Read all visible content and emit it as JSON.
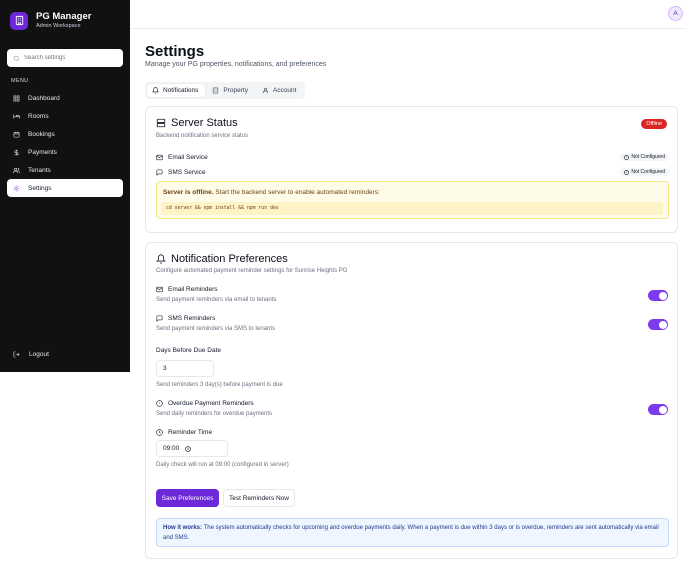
{
  "app": {
    "title": "PG Manager",
    "subtitle": "Admin Workspace"
  },
  "sidebar": {
    "search_placeholder": "Search settings",
    "menu_label": "MENU",
    "items": [
      {
        "label": "Dashboard",
        "icon": "grid-icon"
      },
      {
        "label": "Rooms",
        "icon": "bed-icon"
      },
      {
        "label": "Bookings",
        "icon": "calendar-icon"
      },
      {
        "label": "Payments",
        "icon": "dollar-icon"
      },
      {
        "label": "Tenants",
        "icon": "users-icon"
      },
      {
        "label": "Settings",
        "icon": "gear-icon",
        "active": true
      }
    ],
    "logout_label": "Logout"
  },
  "topbar": {
    "avatar_initial": "A"
  },
  "page": {
    "title": "Settings",
    "subtitle": "Manage your PG properties, notifications, and preferences"
  },
  "tabs": [
    {
      "label": "Notifications",
      "icon": "bell-icon",
      "active": true
    },
    {
      "label": "Property",
      "icon": "building-icon"
    },
    {
      "label": "Account",
      "icon": "user-icon"
    }
  ],
  "server_status": {
    "title": "Server Status",
    "description": "Backend notification service status",
    "status_badge": "Offline",
    "services": [
      {
        "label": "Email Service",
        "icon": "mail-icon",
        "status": "Not Configured"
      },
      {
        "label": "SMS Service",
        "icon": "message-icon",
        "status": "Not Configured"
      }
    ],
    "warning_strong": "Server is offline.",
    "warning_text": " Start the backend server to enable automated reminders:",
    "warning_code": "cd server && npm install && npm run dev"
  },
  "preferences": {
    "title": "Notification Preferences",
    "description": "Configure automated payment reminder settings for Sunrise Heights PG",
    "email": {
      "label": "Email Reminders",
      "desc": "Send payment reminders via email to tenants",
      "enabled": true
    },
    "sms": {
      "label": "SMS Reminders",
      "desc": "Send payment reminders via SMS to tenants",
      "enabled": true
    },
    "days": {
      "label": "Days Before Due Date",
      "value": "3",
      "desc": "Send reminders 3 day(s) before payment is due"
    },
    "overdue": {
      "label": "Overdue Payment Reminders",
      "desc": "Send daily reminders for overdue payments",
      "enabled": true
    },
    "time": {
      "label": "Reminder Time",
      "value": "09:00",
      "desc": "Daily check will run at 09:00 (configured in server)"
    },
    "save_label": "Save Preferences",
    "test_label": "Test Reminders Now",
    "info_strong": "How it works:",
    "info_text": " The system automatically checks for upcoming and overdue payments daily. When a payment is due within 3 days or is overdue, reminders are sent automatically via email and SMS."
  },
  "colors": {
    "accent": "#6d28d9",
    "sidebar_bg": "#111111",
    "offline": "#dc2626",
    "warn_bg": "#fefce8",
    "info_bg": "#eff6ff"
  }
}
